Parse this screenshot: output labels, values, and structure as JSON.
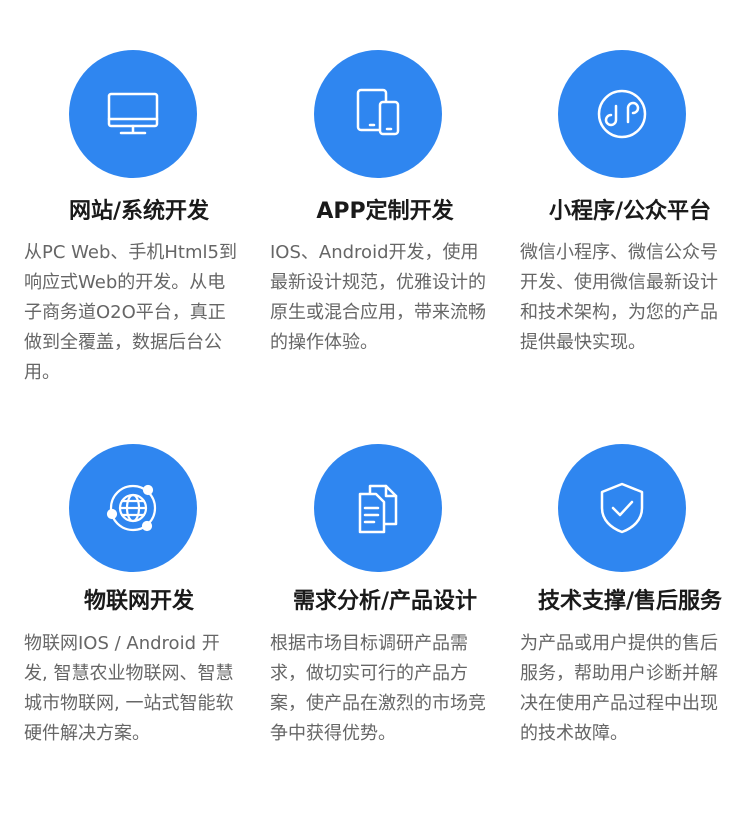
{
  "services": [
    {
      "icon": "monitor-icon",
      "title": "网站/系统开发",
      "desc": "从PC Web、手机Html5到响应式Web的开发。从电子商务道O2O平台，真正做到全覆盖，数据后台公用。"
    },
    {
      "icon": "devices-icon",
      "title": "APP定制开发",
      "desc": "IOS、Android开发，使用最新设计规范，优雅设计的原生或混合应用，带来流畅的操作体验。"
    },
    {
      "icon": "mini-program-icon",
      "title": "小程序/公众平台",
      "desc": "微信小程序、微信公众号开发、使用微信最新设计和技术架构，为您的产品提供最快实现。"
    },
    {
      "icon": "globe-network-icon",
      "title": "物联网开发",
      "desc": "物联网IOS / Android 开发, 智慧农业物联网、智慧城市物联网, 一站式智能软硬件解决方案。"
    },
    {
      "icon": "documents-icon",
      "title": "需求分析/产品设计",
      "desc": "根据市场目标调研产品需求，做切实可行的产品方案，使产品在激烈的市场竞争中获得优势。"
    },
    {
      "icon": "shield-check-icon",
      "title": "技术支撑/售后服务",
      "desc": "为产品或用户提供的售后服务，帮助用户诊断并解决在使用产品过程中出现的技术故障。"
    }
  ],
  "colors": {
    "accent": "#2f86f0",
    "title": "#1a1a1a",
    "text": "#666666"
  }
}
